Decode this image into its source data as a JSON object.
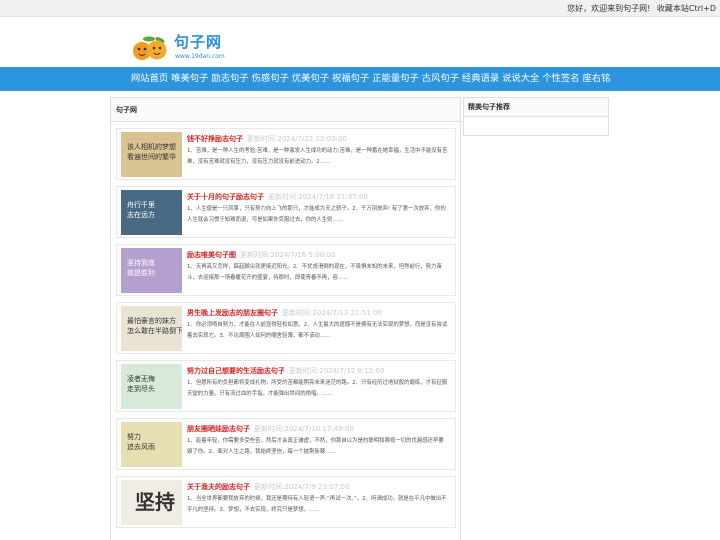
{
  "topbar": {
    "welcome": "您好，欢迎来到句子网!",
    "bookmark": "收藏本站Ctrl+D"
  },
  "logo": {
    "title": "句子网",
    "url": "www.19dan.com"
  },
  "nav": [
    "网站首页",
    "唯美句子",
    "励志句子",
    "伤感句子",
    "优美句子",
    "祝福句子",
    "正能量句子",
    "古风句子",
    "经典语录",
    "说说大全",
    "个性签名",
    "座右铭"
  ],
  "main": {
    "heading": "句子网"
  },
  "side": {
    "heading": "精美句子推荐"
  },
  "date_prefix": "更新时间:",
  "articles": [
    {
      "title": "钱不好挣励志句子",
      "date": "2024/7/22 22:03:00",
      "desc": "1、苦难，是一种人生的考验;苦难，是一种激发人生成功的动力;苦难，是一种蓄在她幸福，生活中不能没有苦难，没有苦难就没有压力，没有压力就没有前进动力。2……",
      "thumb": {
        "bg": "#d9c392",
        "text": "该人相机的梦想\n看遍世间的繁华"
      }
    },
    {
      "title": "关于十月的句子励志句子",
      "date": "2024/7/18 21:37:00",
      "desc": "1、人生便是一只风筝，只有努力向上飞的那只，才能成为天之骄子。2、千万别放弃! 有了第一次放弃，你的人生就会习惯于知难而退，可是如果你克服过去，你的人生则……",
      "thumb": {
        "bg": "#4a6a83",
        "text": "舟行千里\n志在远方"
      }
    },
    {
      "title": "励志唯美句子图",
      "date": "2024/7/16 5:00:00",
      "desc": "1、天再高又怎样，踮起脚尖就更接近阳光。2、不忧虑滑倒的现在，不畏惧未知的未来，坦然前行，努力奋斗，去迎接那一场春暖花开的盛宴，待那时，即使青春不再，容……",
      "thumb": {
        "bg": "#b59fd0",
        "text": "坚持到底\n就是胜利"
      }
    },
    {
      "title": "男生晚上发励志的朋友圈句子",
      "date": "2024/7/13 21:51:00",
      "desc": "1、你必须啃自努力，才能在人前显得轻松如意。2、人生最大的遗憾不是拥有无法实现的梦想，而是没有尝试着去实现它。3、不论周围人如何的嘲舍轻薄，都不该动……",
      "thumb": {
        "bg": "#e9e4d2",
        "text": "最怕豪言的妹方\n怎么敢在半路倒下"
      }
    },
    {
      "title": "努力过自己想要的生活励志句子",
      "date": "2024/7/12 8:12:00",
      "desc": "1、但愿所有的负担都将变成礼物，所受的苦都能照亮未来迷茫的路。2、只有经历过地狱般的磨练，才有征服天堂的力量。只有流过血的手指，才能弹出世间的绝唱。……",
      "thumb": {
        "bg": "#d8e8d9",
        "text": "凌者无悔\n走到尽头"
      }
    },
    {
      "title": "朋友圈晒娃励志句子",
      "date": "2024/7/10 17:49:00",
      "desc": "1、趁着年轻，你需要多受些苦，然后才会真正谦虚，不然，你那自以为是的聪明和眼视一切的优越感还早要毁了你。2、面对人生之路，我始终坚信，每一个披荆斩棘……",
      "thumb": {
        "bg": "#e7dfb1",
        "text": "努力\n追去风雨"
      }
    },
    {
      "title": "关于渔夫的励志句子",
      "date": "2024/7/9 23:07:00",
      "desc": "1、当全世界都要我放弃的时候，我还是期待有人轻语一声:“再试一次。”。2、所谓成功，就是在平凡中做出不平凡的坚持。3、梦想，不去实现，终究只是梦想。……",
      "thumb": {
        "bg": "#f1ede4",
        "text": "坚持"
      }
    }
  ]
}
